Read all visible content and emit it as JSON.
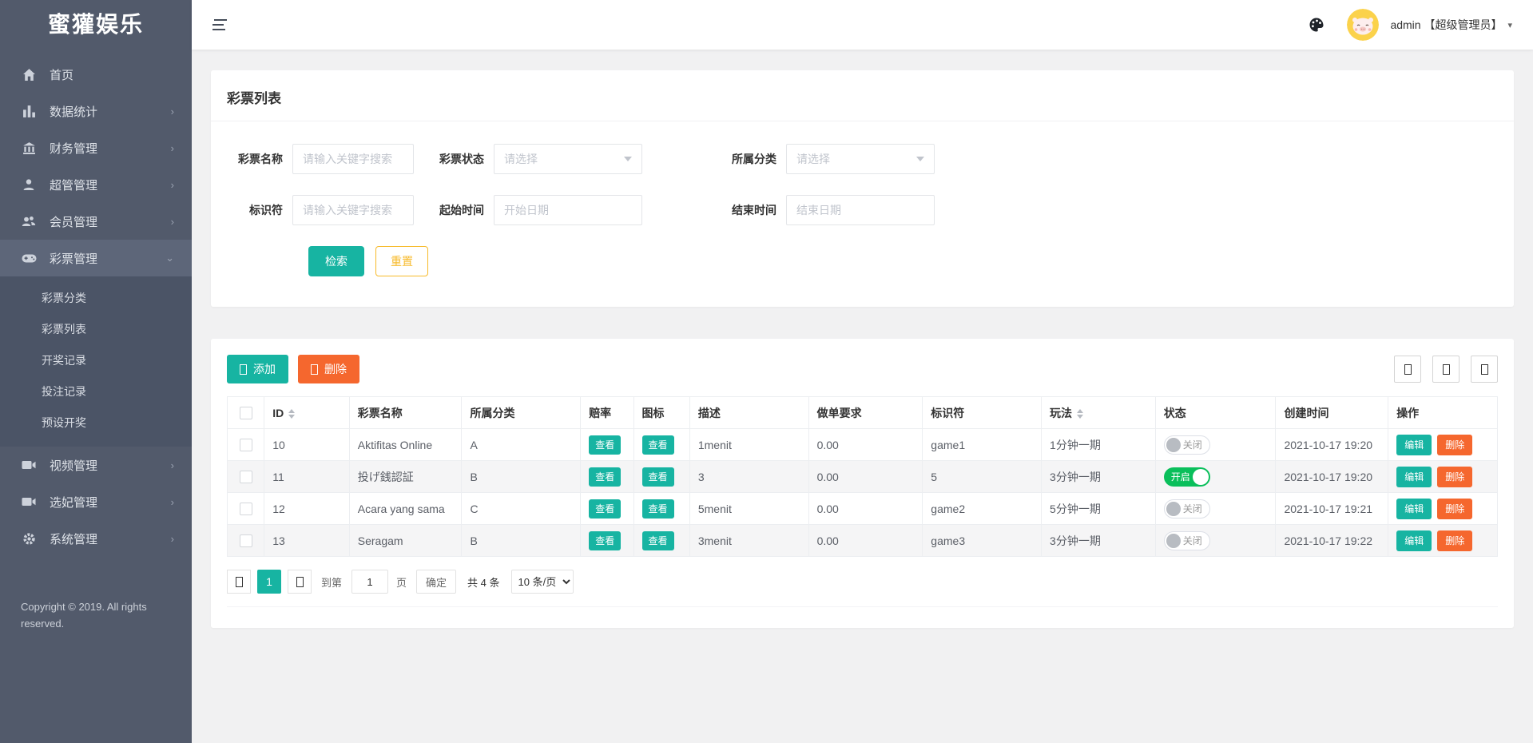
{
  "app": {
    "brand": "蜜獾娱乐"
  },
  "topbar": {
    "user": "admin 【超级管理员】",
    "caret": "▾"
  },
  "sidebar": {
    "items": [
      {
        "label": "首页",
        "arrow": ""
      },
      {
        "label": "数据统计",
        "arrow": "›"
      },
      {
        "label": "财务管理",
        "arrow": "›"
      },
      {
        "label": "超管管理",
        "arrow": "›"
      },
      {
        "label": "会员管理",
        "arrow": "›"
      },
      {
        "label": "彩票管理",
        "arrow": "⌄"
      },
      {
        "label": "视频管理",
        "arrow": "›"
      },
      {
        "label": "选妃管理",
        "arrow": "›"
      },
      {
        "label": "系统管理",
        "arrow": "›"
      }
    ],
    "submenu": [
      {
        "label": "彩票分类"
      },
      {
        "label": "彩票列表"
      },
      {
        "label": "开奖记录"
      },
      {
        "label": "投注记录"
      },
      {
        "label": "预设开奖"
      }
    ],
    "copyright": "Copyright © 2019. All rights reserved."
  },
  "search": {
    "title": "彩票列表",
    "name_label": "彩票名称",
    "name_placeholder": "请输入关键字搜索",
    "status_label": "彩票状态",
    "status_value": "请选择",
    "category_label": "所属分类",
    "category_value": "请选择",
    "ident_label": "标识符",
    "ident_placeholder": "请输入关键字搜索",
    "start_label": "起始时间",
    "start_placeholder": "开始日期",
    "end_label": "结束时间",
    "end_placeholder": "结束日期",
    "search_button": "检索",
    "reset_button": "重置"
  },
  "toolbar": {
    "add_label": "添加",
    "delete_label": "删除"
  },
  "table": {
    "headers": [
      "ID",
      "彩票名称",
      "所属分类",
      "赔率",
      "图标",
      "描述",
      "做单要求",
      "标识符",
      "玩法",
      "状态",
      "创建时间",
      "操作"
    ],
    "view_label": "查看",
    "edit_label": "编辑",
    "delete_label": "删除",
    "rows": [
      {
        "id": "10",
        "name": "Aktifitas Online",
        "category": "A",
        "desc": "1menit",
        "req": "0.00",
        "ident": "game1",
        "play": "1分钟一期",
        "status": "关闭",
        "created": "2021-10-17 19:20"
      },
      {
        "id": "11",
        "name": "投げ銭認証",
        "category": "B",
        "desc": "3",
        "req": "0.00",
        "ident": "5",
        "play": "3分钟一期",
        "status": "开启",
        "created": "2021-10-17 19:20"
      },
      {
        "id": "12",
        "name": "Acara yang sama",
        "category": "C",
        "desc": "5menit",
        "req": "0.00",
        "ident": "game2",
        "play": "5分钟一期",
        "status": "关闭",
        "created": "2021-10-17 19:21"
      },
      {
        "id": "13",
        "name": "Seragam",
        "category": "B",
        "desc": "3menit",
        "req": "0.00",
        "ident": "game3",
        "play": "3分钟一期",
        "status": "关闭",
        "created": "2021-10-17 19:22"
      }
    ]
  },
  "pagination": {
    "current_page": "1",
    "goto_label": "到第",
    "goto_value": "1",
    "page_label": "页",
    "confirm_label": "确定",
    "total_label": "共 4 条",
    "page_size": "10 条/页"
  },
  "colors": {
    "teal": "#17b4a2",
    "orange": "#f5672e",
    "yellow": "#f7ba2a",
    "toggle_green": "#0abf5b",
    "sidebar_bg": "#525a6b"
  }
}
